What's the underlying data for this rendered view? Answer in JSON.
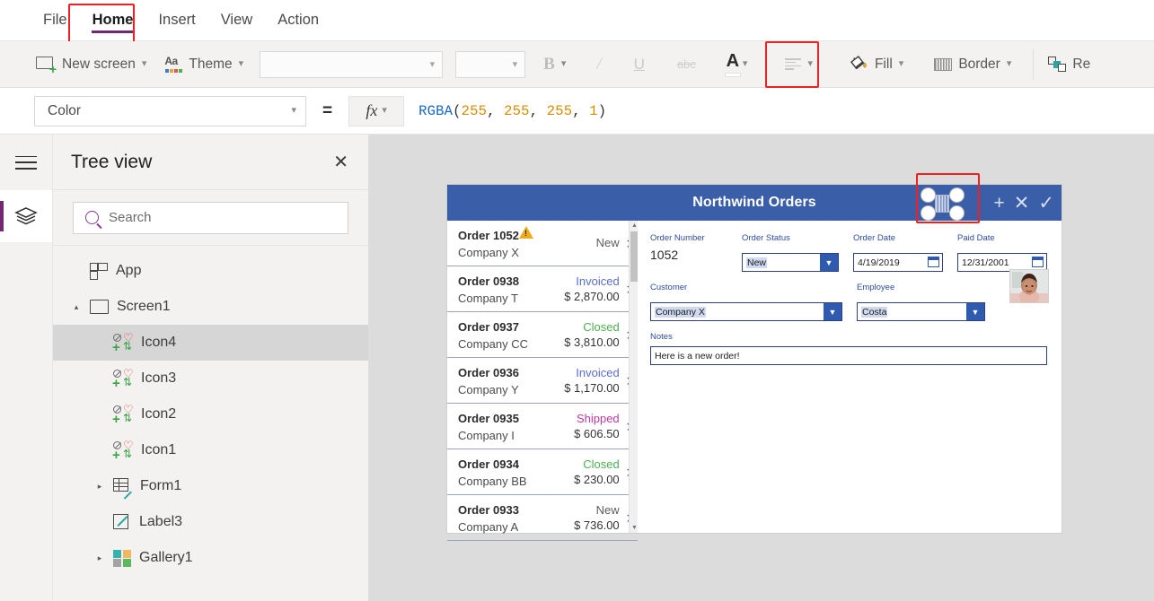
{
  "menu": {
    "items": [
      {
        "label": "File",
        "active": false
      },
      {
        "label": "Home",
        "active": true
      },
      {
        "label": "Insert",
        "active": false
      },
      {
        "label": "View",
        "active": false
      },
      {
        "label": "Action",
        "active": false
      }
    ],
    "active_accent": "#742774"
  },
  "ribbon": {
    "new_screen": {
      "label": "New screen",
      "icon": "new-screen-icon"
    },
    "theme": {
      "label": "Theme",
      "icon": "theme-icon"
    },
    "font_family": {
      "value": "",
      "icon": "chevron-down-icon"
    },
    "font_size": {
      "value": "",
      "icon": "chevron-down-icon"
    },
    "bold": {
      "label": "B"
    },
    "italic": {
      "label": "I"
    },
    "underline": {
      "label": "U"
    },
    "strikethrough": {
      "label": "abc"
    },
    "font_color": {
      "label": "A",
      "selected_color": "#ffffff",
      "highlighted": true
    },
    "align": {
      "label": ""
    },
    "fill": {
      "label": "Fill"
    },
    "border": {
      "label": "Border"
    },
    "reorder": {
      "label": "Re"
    }
  },
  "formula": {
    "property": "Color",
    "equals": "=",
    "fx": "fx",
    "expression_tokens": [
      {
        "text": "RGBA",
        "type": "fn"
      },
      {
        "text": "(",
        "type": "paren"
      },
      {
        "text": "255",
        "type": "num"
      },
      {
        "text": ", ",
        "type": "paren"
      },
      {
        "text": "255",
        "type": "num"
      },
      {
        "text": ", ",
        "type": "paren"
      },
      {
        "text": "255",
        "type": "num"
      },
      {
        "text": ", ",
        "type": "paren"
      },
      {
        "text": "1",
        "type": "num"
      },
      {
        "text": ")",
        "type": "paren"
      }
    ],
    "expression_text": "RGBA(255, 255, 255, 1)"
  },
  "rail": {
    "menu_icon": "hamburger-icon",
    "tree_view_icon": "layers-icon",
    "active_indicator": "#742774"
  },
  "tree_view": {
    "title": "Tree view",
    "close_label": "✕",
    "search_placeholder": "Search",
    "items": [
      {
        "label": "App",
        "icon": "app-icon",
        "indent": 0,
        "caret": "",
        "selected": false
      },
      {
        "label": "Screen1",
        "icon": "screen-icon",
        "indent": 0,
        "caret": "▴",
        "selected": false
      },
      {
        "label": "Icon4",
        "icon": "icons-icon",
        "indent": 1,
        "caret": "",
        "selected": true
      },
      {
        "label": "Icon3",
        "icon": "icons-icon",
        "indent": 1,
        "caret": "",
        "selected": false
      },
      {
        "label": "Icon2",
        "icon": "icons-icon",
        "indent": 1,
        "caret": "",
        "selected": false
      },
      {
        "label": "Icon1",
        "icon": "icons-icon",
        "indent": 1,
        "caret": "",
        "selected": false
      },
      {
        "label": "Form1",
        "icon": "form-icon",
        "indent": 1,
        "caret": "▸",
        "selected": false
      },
      {
        "label": "Label3",
        "icon": "label-icon",
        "indent": 1,
        "caret": "",
        "selected": false
      },
      {
        "label": "Gallery1",
        "icon": "gallery-icon",
        "indent": 1,
        "caret": "▸",
        "selected": false
      }
    ]
  },
  "canvas": {
    "background": "#dcdcdc",
    "app": {
      "header": {
        "title": "Northwind Orders",
        "background": "#3b5ea9",
        "selected_element": "barcode-icon",
        "actions": [
          {
            "name": "add-icon",
            "glyph": "+"
          },
          {
            "name": "cancel-icon",
            "glyph": "✕"
          },
          {
            "name": "confirm-icon",
            "glyph": "✓"
          }
        ]
      },
      "gallery": {
        "rows": [
          {
            "order": "Order 1052",
            "company": "Company X",
            "status": "New",
            "status_color": "#5c5c5c",
            "amount": "",
            "warning": true
          },
          {
            "order": "Order 0938",
            "company": "Company T",
            "status": "Invoiced",
            "status_color": "#5b6ecb",
            "amount": "$ 2,870.00",
            "warning": false
          },
          {
            "order": "Order 0937",
            "company": "Company CC",
            "status": "Closed",
            "status_color": "#4caf50",
            "amount": "$ 3,810.00",
            "warning": false
          },
          {
            "order": "Order 0936",
            "company": "Company Y",
            "status": "Invoiced",
            "status_color": "#5b6ecb",
            "amount": "$ 1,170.00",
            "warning": false
          },
          {
            "order": "Order 0935",
            "company": "Company I",
            "status": "Shipped",
            "status_color": "#c0399f",
            "amount": "$ 606.50",
            "warning": false
          },
          {
            "order": "Order 0934",
            "company": "Company BB",
            "status": "Closed",
            "status_color": "#4caf50",
            "amount": "$ 230.00",
            "warning": false
          },
          {
            "order": "Order 0933",
            "company": "Company A",
            "status": "New",
            "status_color": "#5c5c5c",
            "amount": "$ 736.00",
            "warning": false
          }
        ],
        "chevron": "›"
      },
      "form": {
        "order_number": {
          "label": "Order Number",
          "value": "1052"
        },
        "order_status": {
          "label": "Order Status",
          "value": "New"
        },
        "order_date": {
          "label": "Order Date",
          "value": "4/19/2019"
        },
        "paid_date": {
          "label": "Paid Date",
          "value": "12/31/2001"
        },
        "customer": {
          "label": "Customer",
          "value": "Company X"
        },
        "employee": {
          "label": "Employee",
          "value": "Costa"
        },
        "notes": {
          "label": "Notes",
          "value": "Here is a new order!"
        },
        "avatar": "employee-photo"
      }
    }
  },
  "annotations": {
    "color": "#f02020",
    "boxes": [
      "home-tab",
      "font-color-button",
      "selected-canvas-icon"
    ]
  }
}
